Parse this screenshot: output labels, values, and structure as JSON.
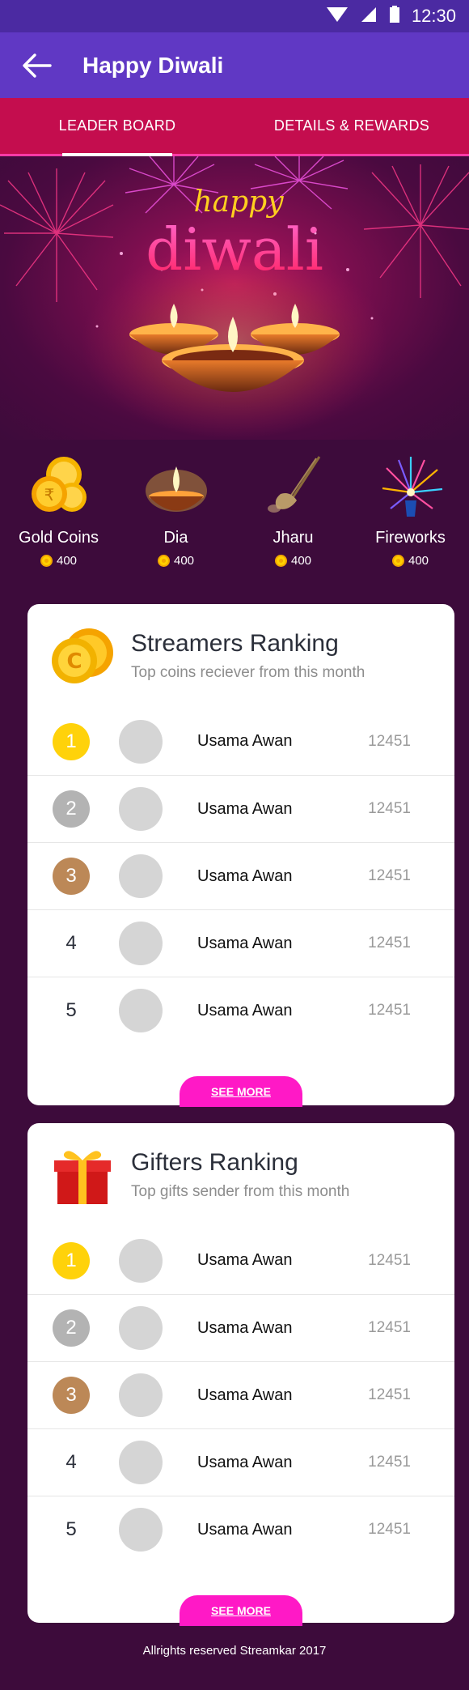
{
  "status_bar": {
    "time": "12:30"
  },
  "app_bar": {
    "title": "Happy Diwali"
  },
  "tabs": [
    {
      "label": "LEADER BOARD",
      "active": true
    },
    {
      "label": "DETAILS & REWARDS",
      "active": false
    }
  ],
  "hero": {
    "word_top": "happy",
    "word_main": "diwali"
  },
  "gifts": [
    {
      "name": "Gold Coins",
      "price": "400",
      "icon": "gold-coins-icon"
    },
    {
      "name": "Dia",
      "price": "400",
      "icon": "dia-icon"
    },
    {
      "name": "Jharu",
      "price": "400",
      "icon": "jharu-icon"
    },
    {
      "name": "Fireworks",
      "price": "400",
      "icon": "fireworks-icon"
    }
  ],
  "streamers": {
    "title": "Streamers Ranking",
    "subtitle": "Top coins reciever from this month",
    "rows": [
      {
        "rank": "1",
        "name": "Usama Awan",
        "score": "12451"
      },
      {
        "rank": "2",
        "name": "Usama Awan",
        "score": "12451"
      },
      {
        "rank": "3",
        "name": "Usama Awan",
        "score": "12451"
      },
      {
        "rank": "4",
        "name": "Usama Awan",
        "score": "12451"
      },
      {
        "rank": "5",
        "name": "Usama Awan",
        "score": "12451"
      }
    ],
    "see_more": "SEE MORE"
  },
  "gifters": {
    "title": "Gifters Ranking",
    "subtitle": "Top gifts sender from this month",
    "rows": [
      {
        "rank": "1",
        "name": "Usama Awan",
        "score": "12451"
      },
      {
        "rank": "2",
        "name": "Usama Awan",
        "score": "12451"
      },
      {
        "rank": "3",
        "name": "Usama Awan",
        "score": "12451"
      },
      {
        "rank": "4",
        "name": "Usama Awan",
        "score": "12451"
      },
      {
        "rank": "5",
        "name": "Usama Awan",
        "score": "12451"
      }
    ],
    "see_more": "SEE MORE"
  },
  "footer": {
    "text": "Allrights reserved Streamkar 2017"
  },
  "colors": {
    "status_bar": "#4b2aa2",
    "app_bar": "#6038c4",
    "tab_bar": "#c40d4e",
    "background": "#3d0b3b",
    "see_more": "#ff19c6",
    "rank_gold": "#ffd20a",
    "rank_silver": "#b3b3b3",
    "rank_bronze": "#bc8857"
  }
}
